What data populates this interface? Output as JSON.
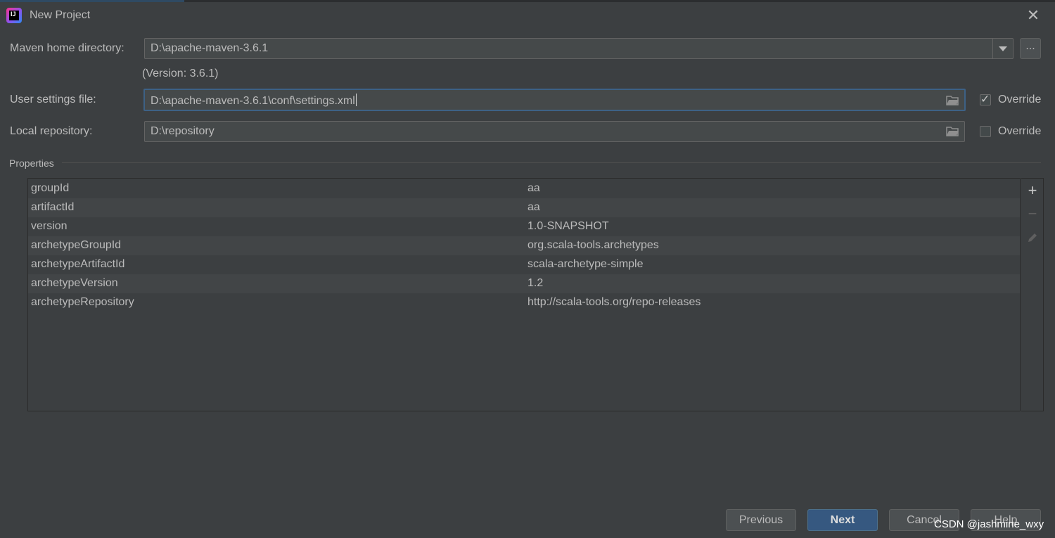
{
  "window": {
    "title": "New Project"
  },
  "form": {
    "maven_home": {
      "label": "Maven home directory:",
      "value": "D:\\apache-maven-3.6.1",
      "browse": "..."
    },
    "version_note": "(Version: 3.6.1)",
    "user_settings": {
      "label": "User settings file:",
      "value": "D:\\apache-maven-3.6.1\\conf\\settings.xml",
      "override_label": "Override",
      "override_checked": true
    },
    "local_repo": {
      "label": "Local repository:",
      "value": "D:\\repository",
      "override_label": "Override",
      "override_checked": false
    }
  },
  "properties": {
    "header": "Properties",
    "rows": [
      {
        "key": "groupId",
        "value": "aa"
      },
      {
        "key": "artifactId",
        "value": "aa"
      },
      {
        "key": "version",
        "value": "1.0-SNAPSHOT"
      },
      {
        "key": "archetypeGroupId",
        "value": "org.scala-tools.archetypes"
      },
      {
        "key": "archetypeArtifactId",
        "value": "scala-archetype-simple"
      },
      {
        "key": "archetypeVersion",
        "value": "1.2"
      },
      {
        "key": "archetypeRepository",
        "value": "http://scala-tools.org/repo-releases"
      }
    ]
  },
  "icons": {
    "app": "intellij-idea-icon",
    "close": "close-icon",
    "add": "plus-icon",
    "remove": "minus-icon",
    "edit": "pencil-icon",
    "folder": "folder-icon"
  },
  "buttons": {
    "previous": "Previous",
    "next": "Next",
    "cancel": "Cancel",
    "help": "Help"
  },
  "watermark": "CSDN @jashmine_wxy"
}
